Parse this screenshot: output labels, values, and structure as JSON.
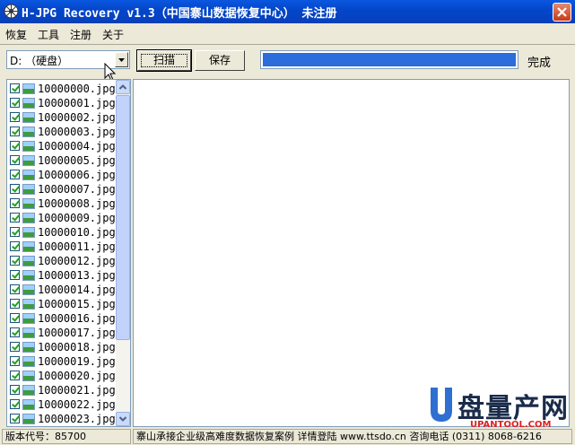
{
  "window": {
    "title": "H-JPG Recovery v1.3（中国寨山数据恢复中心） 未注册"
  },
  "menu": [
    "恢复",
    "工具",
    "注册",
    "关于"
  ],
  "toolbar": {
    "drive_value": "D: （硬盘）",
    "scan_label": "扫描",
    "save_label": "保存",
    "progress": 1.0,
    "status": "完成"
  },
  "files": [
    "10000000.jpg",
    "10000001.jpg",
    "10000002.jpg",
    "10000003.jpg",
    "10000004.jpg",
    "10000005.jpg",
    "10000006.jpg",
    "10000007.jpg",
    "10000008.jpg",
    "10000009.jpg",
    "10000010.jpg",
    "10000011.jpg",
    "10000012.jpg",
    "10000013.jpg",
    "10000014.jpg",
    "10000015.jpg",
    "10000016.jpg",
    "10000017.jpg",
    "10000018.jpg",
    "10000019.jpg",
    "10000020.jpg",
    "10000021.jpg",
    "10000022.jpg",
    "10000023.jpg"
  ],
  "statusbar": {
    "version": "版本代号：85700",
    "info": "寨山承接企业级高难度数据恢复案例 详情登陆 www.ttsdo.cn 咨询电话 (0311) 8068-6216"
  },
  "watermark": {
    "text": "盘量产网",
    "url": "UPANTOOL.COM"
  },
  "colors": {
    "titlebar": "#0446c9",
    "progress_fill": "#2a6ddb",
    "window_bg": "#ece9d8"
  }
}
